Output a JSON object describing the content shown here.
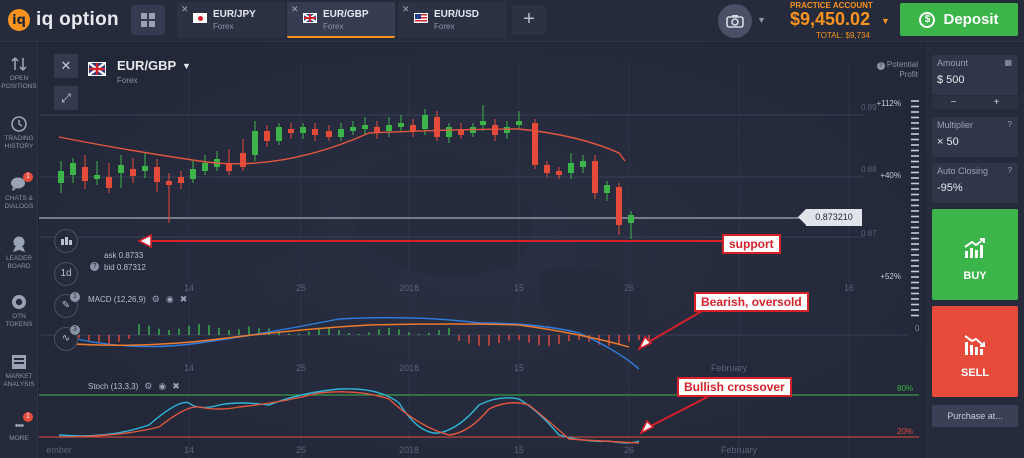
{
  "header": {
    "logo_text": "iq option",
    "logo_mark": "iq",
    "tabs": [
      {
        "pair": "EUR/JPY",
        "market": "Forex",
        "flag": "japan-flag",
        "active": false
      },
      {
        "pair": "EUR/GBP",
        "market": "Forex",
        "flag": "uk-flag",
        "active": true
      },
      {
        "pair": "EUR/USD",
        "market": "Forex",
        "flag": "usa-flag",
        "active": false
      }
    ],
    "add_tab_label": "+",
    "close_tab_icon": "✕",
    "account_type": "PRACTICE ACCOUNT",
    "balance": "$9,450.02",
    "total": "TOTAL: $9,734",
    "deposit_label": "Deposit",
    "deposit_icon": "$"
  },
  "sidebar": {
    "items": [
      {
        "label": "OPEN POSITIONS",
        "icon": "arrows-updown-icon",
        "glyph": "⇅",
        "badge": ""
      },
      {
        "label": "TRADING HISTORY",
        "icon": "history-icon",
        "glyph": "↺",
        "badge": ""
      },
      {
        "label": "CHATS & DIALOGS",
        "icon": "chat-icon",
        "glyph": "💬",
        "badge": "1"
      },
      {
        "label": "LEADER BOARD",
        "icon": "trophy-icon",
        "glyph": "♛",
        "badge": ""
      },
      {
        "label": "OTN TOKENS",
        "icon": "token-icon",
        "glyph": "◉",
        "badge": ""
      },
      {
        "label": "MARKET ANALYSIS",
        "icon": "analysis-icon",
        "glyph": "▤",
        "badge": ""
      },
      {
        "label": "MORE",
        "icon": "more-icon",
        "glyph": "•••",
        "badge": "1"
      }
    ]
  },
  "chart": {
    "asset": "EUR/GBP",
    "market": "Forex",
    "close_icon": "✕",
    "expand_icon": "⤢",
    "potential_profit": "Potential Profit",
    "ask": "ask 0.8733",
    "bid": "bid 0.87312",
    "info": "?",
    "price_tag": "0.873210",
    "timeframe": "1d",
    "tool_badge_1": "1",
    "tool_badge_2": "3",
    "macd_label": "MACD (12,26,9)",
    "stoch_label": "Stoch (13,3,3)",
    "gear": "⚙",
    "eye": "◉",
    "remove": "✖",
    "profit_levels": [
      "+112%",
      "+40%",
      "+52%"
    ],
    "price_levels": [
      "0.89",
      "0.88",
      "0.87"
    ],
    "macd_zero": "0",
    "stoch_80": "80%",
    "stoch_20": "20%",
    "x_labels_main": [
      "14",
      "25",
      "2018",
      "15",
      "26",
      "16"
    ],
    "x_labels_macd": [
      "14",
      "25",
      "2018",
      "15",
      "February"
    ],
    "x_labels_stoch": [
      "ember",
      "14",
      "25",
      "2018",
      "15",
      "26",
      "February"
    ]
  },
  "annotations": {
    "support": "support",
    "bearish": "Bearish, oversold",
    "bullish": "Bullish crossover"
  },
  "panel": {
    "amount_label": "Amount",
    "amount_value": "$  500",
    "minus": "−",
    "plus": "+",
    "multiplier_label": "Multiplier",
    "multiplier_value": "× 50",
    "auto_close_label": "Auto Closing",
    "auto_close_value": "-95%",
    "buy_label": "BUY",
    "sell_label": "SELL",
    "purchase_label": "Purchase at..."
  },
  "colors": {
    "accent": "#f7931e",
    "buy": "#3bb54a",
    "sell": "#e64a3b",
    "candle_up": "#3bb54a",
    "candle_down": "#e64a3b",
    "ma_line": "#e2563f",
    "macd_line": "#2f7de1",
    "signal_line": "#f07a2c",
    "stoch_k": "#2fb6d9",
    "stoch_d": "#e2563f",
    "annotation": "#d6202a"
  }
}
